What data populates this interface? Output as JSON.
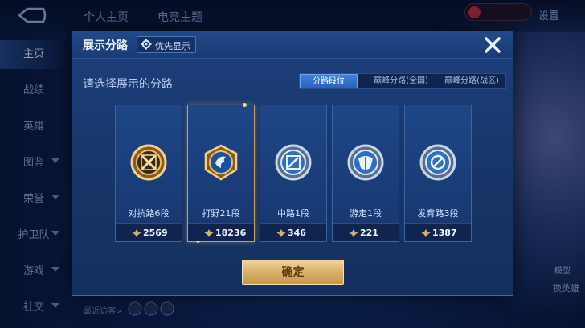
{
  "top": {
    "tabs": [
      "个人主页",
      "电竞主题"
    ],
    "settings_label": "设置"
  },
  "sidebar": {
    "items": [
      {
        "label": "主页",
        "active": true
      },
      {
        "label": "战绩"
      },
      {
        "label": "英雄"
      },
      {
        "label": "图鉴"
      },
      {
        "label": "荣誉"
      },
      {
        "label": "护卫队"
      },
      {
        "label": "游戏"
      },
      {
        "label": "社交"
      }
    ]
  },
  "background": {
    "chat_prompt": "最近访客>",
    "right_label_1": "模型",
    "right_label_2": "换英雄"
  },
  "modal": {
    "title": "展示分路",
    "priority_button": "优先显示",
    "prompt": "请选择展示的分路",
    "tabs": [
      "分路段位",
      "巅峰分路(全国)",
      "巅峰分路(战区)"
    ],
    "active_tab": "分路段位",
    "cards": [
      {
        "name": "对抗路6段",
        "score": "2569",
        "emblem": "gold-sword-emblem-icon"
      },
      {
        "name": "打野21段",
        "score": "18236",
        "emblem": "dragon-emblem-icon",
        "selected": true
      },
      {
        "name": "中路1段",
        "score": "346",
        "emblem": "mid-lane-emblem-icon"
      },
      {
        "name": "游走1段",
        "score": "221",
        "emblem": "support-emblem-icon"
      },
      {
        "name": "发育路3段",
        "score": "1387",
        "emblem": "marksman-emblem-icon"
      }
    ],
    "confirm_label": "确定",
    "colors": {
      "accent_gold": "#d9b06a",
      "tab_active": "#3f82d8",
      "panel": "#1d3f7c"
    }
  }
}
